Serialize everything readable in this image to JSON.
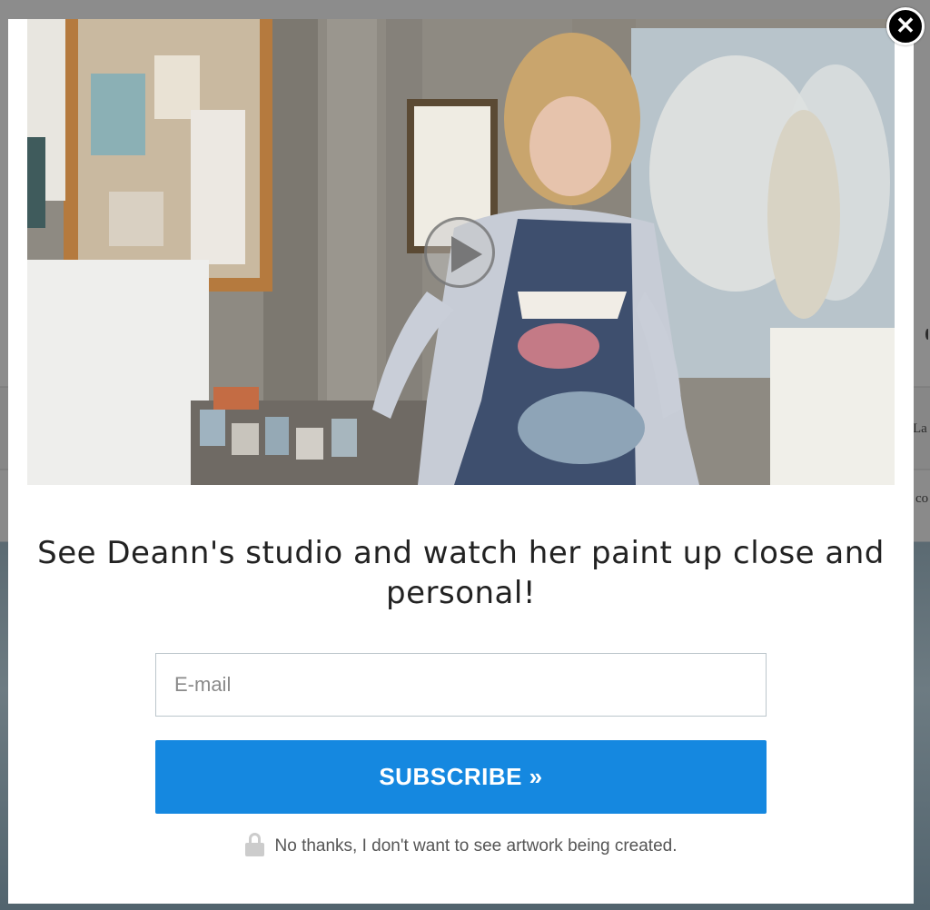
{
  "background": {
    "snippets": [
      "La",
      "co"
    ]
  },
  "modal": {
    "close_label": "✕",
    "headline": "See Deann's studio and watch her paint up close and personal!",
    "email": {
      "placeholder": "E-mail",
      "value": ""
    },
    "subscribe_label": "SUBSCRIBE »",
    "decline_label": "No thanks, I don't want to see artwork being created.",
    "video": {
      "play_icon": "play-icon"
    }
  },
  "colors": {
    "accent": "#1588e0",
    "close": "#000000"
  }
}
